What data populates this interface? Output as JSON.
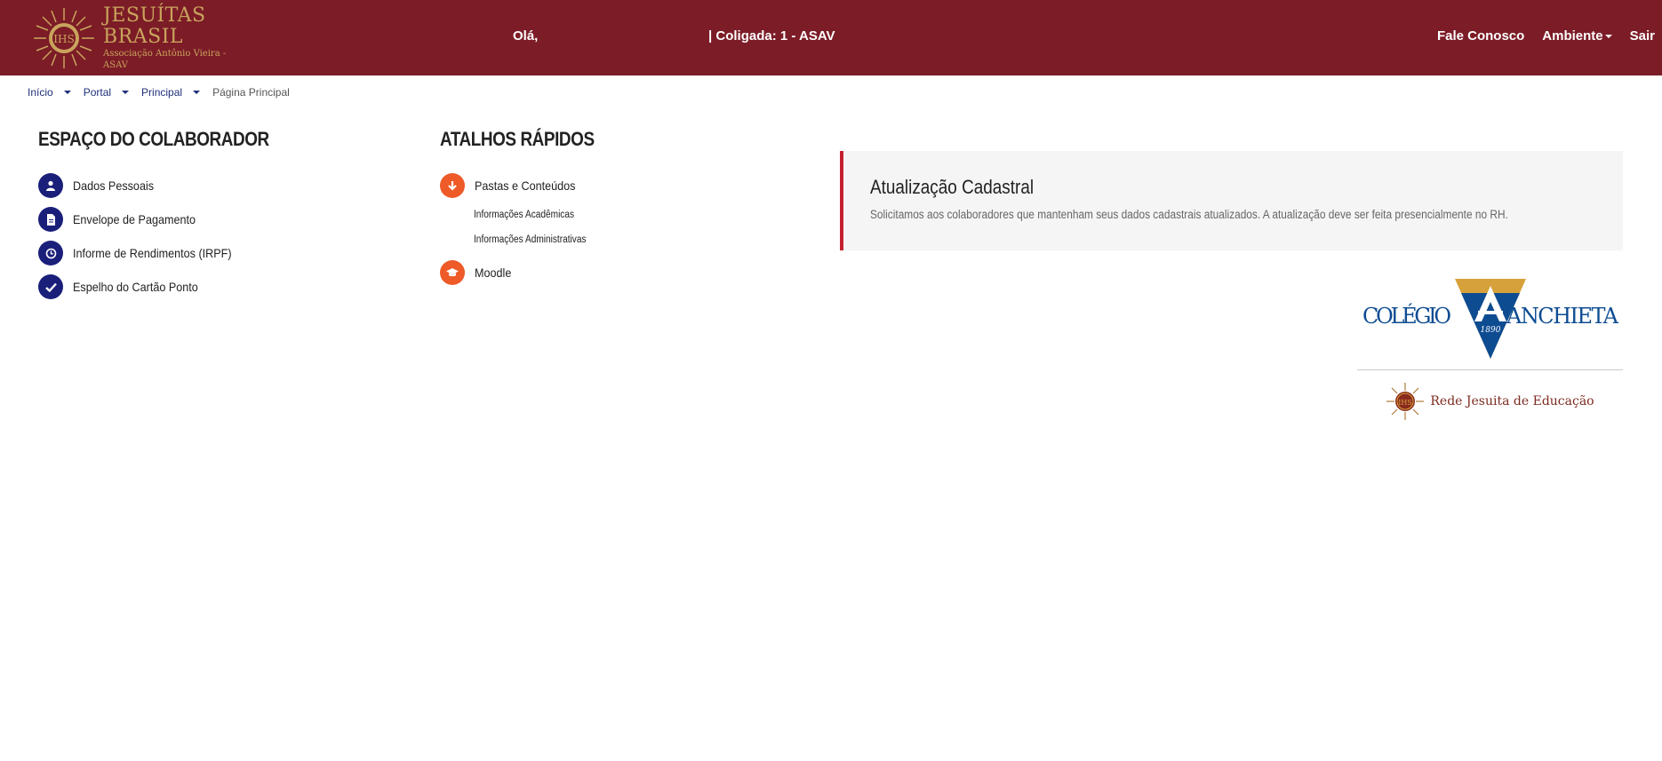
{
  "header": {
    "logo_title": "JESUÍTAS BRASIL",
    "logo_subtitle": "Associação Antônio Vieira - ASAV",
    "greeting": "Olá,",
    "coligada": "|  Coligada: 1 - ASAV",
    "nav": {
      "contact": "Fale Conosco",
      "ambiente": "Ambiente",
      "logout": "Sair"
    },
    "colors": {
      "bar": "#7c1c27",
      "gold": "#c9a45c"
    }
  },
  "breadcrumb": {
    "items": [
      "Início",
      "Portal",
      "Principal"
    ],
    "current": "Página Principal"
  },
  "colaborador": {
    "title": "ESPAÇO DO COLABORADOR",
    "items": [
      {
        "label": "Dados Pessoais",
        "icon": "user-icon"
      },
      {
        "label": "Envelope de Pagamento",
        "icon": "document-icon"
      },
      {
        "label": "Informe de Rendimentos (IRPF)",
        "icon": "clock-icon"
      },
      {
        "label": "Espelho do Cartão Ponto",
        "icon": "check-icon"
      }
    ]
  },
  "atalhos": {
    "title": "ATALHOS RÁPIDOS",
    "items": [
      {
        "label": "Pastas e Conteúdos",
        "icon": "download-arrow-icon",
        "subitems": [
          "Informações Acadêmicas",
          "Informações Administrativas"
        ]
      },
      {
        "label": "Moodle",
        "icon": "graduation-cap-icon"
      }
    ]
  },
  "notice": {
    "title": "Atualização Cadastral",
    "text": "Solicitamos aos colaboradores que mantenham seus dados cadastrais atualizados. A atualização deve ser feita presencialmente no RH."
  },
  "logos": {
    "anchieta_left": "COLÉGIO",
    "anchieta_right": "ANCHIETA",
    "anchieta_year": "1890",
    "rede": "Rede Jesuita de Educação"
  }
}
